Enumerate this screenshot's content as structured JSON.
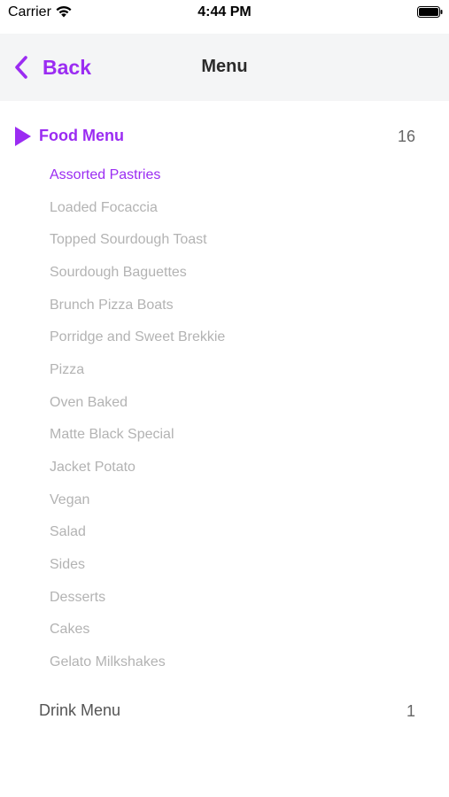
{
  "status_bar": {
    "carrier": "Carrier",
    "time": "4:44 PM",
    "wifi_icon": "wifi-icon",
    "battery_icon": "battery-full-icon"
  },
  "nav_bar": {
    "back_label": "Back",
    "title": "Menu",
    "back_icon": "chevron-left-icon"
  },
  "accent_color": "#9b2cf2",
  "sections": [
    {
      "title": "Food Menu",
      "count": "16",
      "expanded": true,
      "icon": "triangle-right-icon",
      "items": [
        {
          "label": "Assorted Pastries",
          "selected": true
        },
        {
          "label": "Loaded Focaccia"
        },
        {
          "label": "Topped Sourdough Toast"
        },
        {
          "label": "Sourdough Baguettes"
        },
        {
          "label": "Brunch Pizza Boats"
        },
        {
          "label": "Porridge and Sweet Brekkie"
        },
        {
          "label": "Pizza"
        },
        {
          "label": "Oven Baked"
        },
        {
          "label": "Matte Black Special"
        },
        {
          "label": "Jacket Potato"
        },
        {
          "label": "Vegan"
        },
        {
          "label": "Salad"
        },
        {
          "label": "Sides"
        },
        {
          "label": "Desserts"
        },
        {
          "label": "Cakes"
        },
        {
          "label": "Gelato Milkshakes"
        }
      ]
    },
    {
      "title": "Drink Menu",
      "count": "1",
      "expanded": false
    }
  ]
}
